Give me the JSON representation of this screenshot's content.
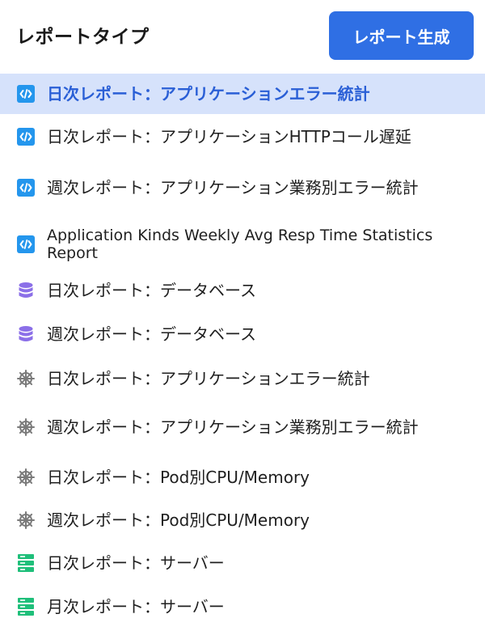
{
  "header": {
    "title": "レポートタイプ",
    "generate_label": "レポート生成"
  },
  "colors": {
    "accent": "#2f6fe4",
    "selected_bg": "#d6e2fb",
    "selected_text": "#2a5fd6",
    "code_icon": "#2496ed",
    "database_icon": "#8b6fe8",
    "k8s_icon": "#7a7a7a",
    "server_icon": "#1fbf7a"
  },
  "report_types": [
    {
      "icon": "code-icon",
      "label": "日次レポート：アプリケーションエラー統計",
      "selected": true
    },
    {
      "icon": "code-icon",
      "label": "日次レポート：アプリケーションHTTPコール遅延",
      "selected": false
    },
    {
      "icon": "code-icon",
      "label": "週次レポート：アプリケーション業務別エラー統計",
      "selected": false
    },
    {
      "icon": "code-icon",
      "label": "Application Kinds Weekly Avg Resp Time Statistics Report",
      "selected": false
    },
    {
      "icon": "database-icon",
      "label": "日次レポート：データベース",
      "selected": false
    },
    {
      "icon": "database-icon",
      "label": "週次レポート：データベース",
      "selected": false
    },
    {
      "icon": "kubernetes-icon",
      "label": "日次レポート：アプリケーションエラー統計",
      "selected": false
    },
    {
      "icon": "kubernetes-icon",
      "label": "週次レポート：アプリケーション業務別エラー統計",
      "selected": false
    },
    {
      "icon": "kubernetes-icon",
      "label": "日次レポート：Pod別CPU/Memory",
      "selected": false
    },
    {
      "icon": "kubernetes-icon",
      "label": "週次レポート：Pod別CPU/Memory",
      "selected": false
    },
    {
      "icon": "server-icon",
      "label": "日次レポート：サーバー",
      "selected": false
    },
    {
      "icon": "server-icon",
      "label": "月次レポート：サーバー",
      "selected": false
    }
  ]
}
